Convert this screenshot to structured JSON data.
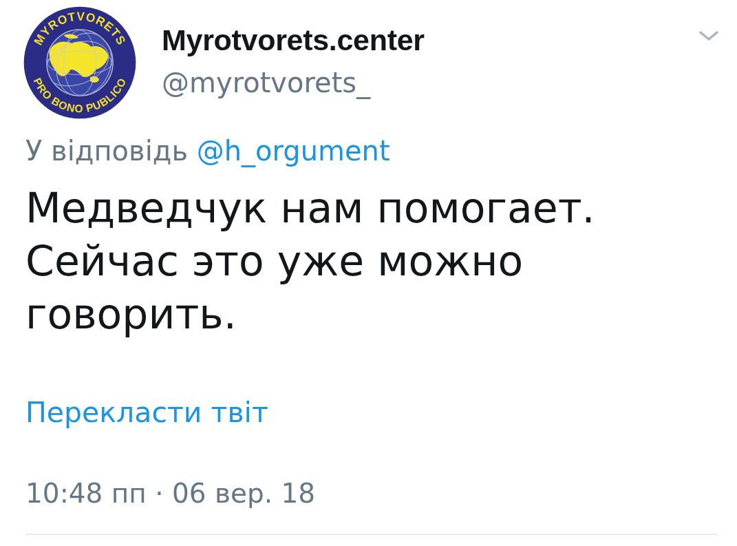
{
  "tweet": {
    "avatar": {
      "top_text": "MYROTVORETS",
      "bottom_text": "PRO BONO PUBLICO"
    },
    "display_name": "Myrotvorets.center",
    "handle": "@myrotvorets_",
    "reply_context": {
      "label": "У відповідь",
      "mention": "@h_orgument"
    },
    "text": "Медведчук нам помогает. Сейчас это уже можно говорить.",
    "translate_link": "Перекласти твіт",
    "timestamp": "10:48 пп · 06 вер. 18"
  }
}
